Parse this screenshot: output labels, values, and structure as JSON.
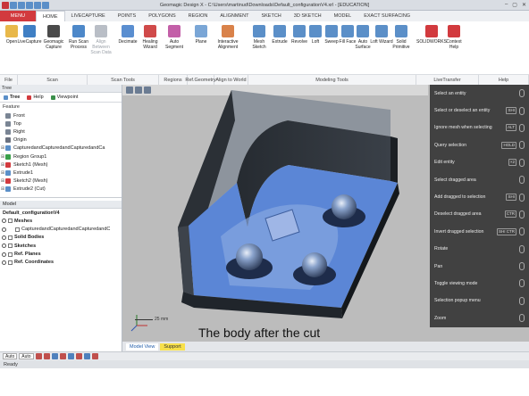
{
  "window": {
    "title": "Geomagic Design X - C:\\Users\\martinud\\Downloads\\Default_configurationV4.xrl - [EDUCATION]"
  },
  "ribbon": {
    "tabs": [
      "MENU",
      "HOME",
      "LIVECAPTURE",
      "POINTS",
      "POLYGONS",
      "REGION",
      "ALIGNMENT",
      "SKETCH",
      "3D SKETCH",
      "MODEL",
      "EXACT SURFACING"
    ],
    "active_tab": "HOME",
    "buttons": [
      {
        "label": "Open",
        "icon": "folder-icon",
        "color": "#e8b84a",
        "disabled": false
      },
      {
        "label": "LiveCapture",
        "icon": "capture-icon",
        "color": "#3f7fc4",
        "disabled": false
      },
      {
        "label": "Geomagic Capture",
        "icon": "scanner-icon",
        "color": "#4a4a4a",
        "disabled": false
      },
      {
        "label": "Run Scan Process",
        "icon": "scan-process-icon",
        "color": "#4d88c9",
        "disabled": false
      },
      {
        "label": "Align Between Scan Data",
        "icon": "align-scan-icon",
        "color": "#b9bec6",
        "disabled": true
      },
      {
        "label": "Decimate",
        "icon": "decimate-icon",
        "color": "#5a8ed0",
        "disabled": false
      },
      {
        "label": "Healing Wizard",
        "icon": "healing-icon",
        "color": "#d04a4a",
        "disabled": false
      },
      {
        "label": "Auto Segment",
        "icon": "segment-icon",
        "color": "#c35fa8",
        "disabled": false
      },
      {
        "label": "Plane",
        "icon": "plane-icon",
        "color": "#7aa6d6",
        "disabled": false
      },
      {
        "label": "Interactive Alignment",
        "icon": "alignment-icon",
        "color": "#d9824a",
        "disabled": false
      },
      {
        "label": "Mesh Sketch",
        "icon": "mesh-sketch-icon",
        "color": "#5b8fc8",
        "disabled": false
      },
      {
        "label": "Extrude",
        "icon": "extrude-icon",
        "color": "#5b8fc8",
        "disabled": false
      },
      {
        "label": "Revolve",
        "icon": "revolve-icon",
        "color": "#5b8fc8",
        "disabled": false
      },
      {
        "label": "Loft",
        "icon": "loft-icon",
        "color": "#5b8fc8",
        "disabled": false
      },
      {
        "label": "Sweep",
        "icon": "sweep-icon",
        "color": "#5b8fc8",
        "disabled": false
      },
      {
        "label": "Fill Face",
        "icon": "fill-face-icon",
        "color": "#5b8fc8",
        "disabled": false
      },
      {
        "label": "Auto Surface",
        "icon": "auto-surface-icon",
        "color": "#5b8fc8",
        "disabled": false
      },
      {
        "label": "Loft Wizard",
        "icon": "loft-wizard-icon",
        "color": "#5b8fc8",
        "disabled": false
      },
      {
        "label": "Solid Primitive",
        "icon": "solid-primitive-icon",
        "color": "#5b8fc8",
        "disabled": false
      },
      {
        "label": "SOLIDWORKS",
        "icon": "solidworks-icon",
        "color": "#d23a3e",
        "disabled": false
      },
      {
        "label": "Context Help",
        "icon": "help-icon",
        "color": "#d23a3e",
        "disabled": false
      }
    ],
    "groups": [
      "File",
      "Scan",
      "Scan Tools",
      "Regions",
      "Ref.Geometry",
      "Align to World",
      "Modeling Tools",
      "LiveTransfer",
      "Help"
    ]
  },
  "tree": {
    "panel_title": "Tree",
    "subtabs": [
      "Tree",
      "Help",
      "Viewpoint"
    ],
    "section_label": "Feature",
    "items": [
      {
        "label": "Front"
      },
      {
        "label": "Top"
      },
      {
        "label": "Right"
      },
      {
        "label": "Origin"
      },
      {
        "label": "CapturedandCapturedandCapturedandCa"
      },
      {
        "label": "Region Group1"
      },
      {
        "label": "Sketch1 (Mesh)"
      },
      {
        "label": "Extrude1"
      },
      {
        "label": "Sketch2 (Mesh)"
      },
      {
        "label": "Extrude2 (Cut)"
      }
    ]
  },
  "model": {
    "panel_title": "Model",
    "items": [
      {
        "label": "Default_configurationV4",
        "bold": true
      },
      {
        "label": "Meshes",
        "bold": true
      },
      {
        "label": "CapturedandCapturedandCapturedandC",
        "bold": false
      },
      {
        "label": "Solid Bodies",
        "bold": true
      },
      {
        "label": "Sketches",
        "bold": true
      },
      {
        "label": "Ref. Planes",
        "bold": true
      },
      {
        "label": "Ref. Coordinates",
        "bold": true
      }
    ]
  },
  "context_menu": {
    "items": [
      {
        "label": "Select an entity",
        "key": "",
        "mouse": true
      },
      {
        "label": "Select or deselect an entity",
        "key": "SHI",
        "mouse": true
      },
      {
        "label": "Ignore mesh when selecting",
        "key": "ALT",
        "mouse": true
      },
      {
        "label": "Query selection",
        "key": "HOLD",
        "mouse": true
      },
      {
        "label": "Edit entity",
        "key": "×2",
        "mouse": true
      },
      {
        "label": "Select dragged area",
        "key": "",
        "mouse": true
      },
      {
        "label": "Add dragged to selection",
        "key": "SHI",
        "mouse": true
      },
      {
        "label": "Deselect dragged area",
        "key": "CTR",
        "mouse": true
      },
      {
        "label": "Invert dragged selection",
        "key": "SHI CTR",
        "mouse": true
      },
      {
        "label": "Rotate",
        "key": "",
        "mouse": true
      },
      {
        "label": "Pan",
        "key": "",
        "mouse": true
      },
      {
        "label": "Toggle viewing mode",
        "key": "",
        "mouse": true
      },
      {
        "label": "Selection popup menu",
        "key": "",
        "mouse": true
      },
      {
        "label": "Zoom",
        "key": "",
        "mouse": true
      }
    ]
  },
  "viewport": {
    "caption": "The body after the cut",
    "scale": "25 mm"
  },
  "bottom_tabs": [
    "Model View",
    "Support"
  ],
  "bottom_toolbar": {
    "select1": "Auto",
    "select2": "Auto"
  },
  "status": "Ready",
  "colors": {
    "accent": "#d23a3e",
    "mesh_blue": "#5b86d6",
    "body": "#1f2429"
  }
}
